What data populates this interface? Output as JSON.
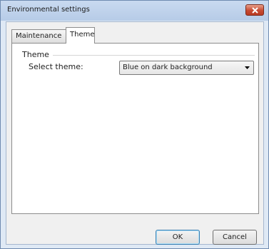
{
  "window": {
    "title": "Environmental settings",
    "close_label": "x"
  },
  "tabs": [
    {
      "label": "Maintenance",
      "active": false
    },
    {
      "label": "Theme",
      "active": true
    }
  ],
  "theme_panel": {
    "group_label": "Theme",
    "field_label": "Select theme:",
    "select_value": "Blue on dark background"
  },
  "buttons": {
    "ok_label": "OK",
    "cancel_label": "Cancel"
  },
  "colors": {
    "titlebar": "#c9daf0",
    "close_button": "#c74a32",
    "ok_border": "#3c7fb1"
  }
}
